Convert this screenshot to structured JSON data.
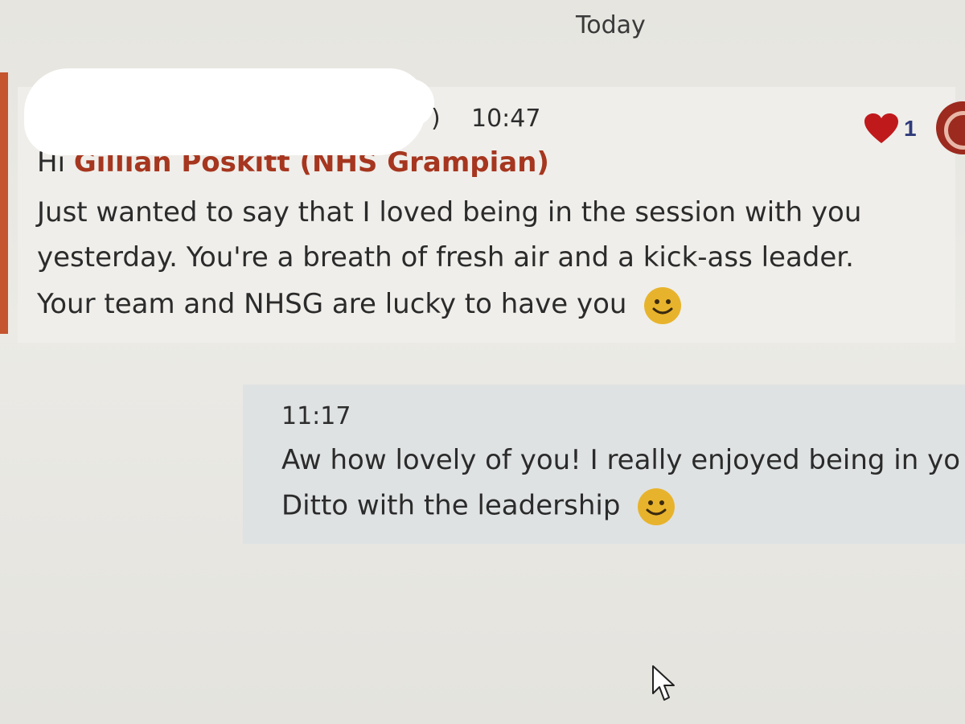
{
  "divider": {
    "date_label": "Today"
  },
  "incoming_message": {
    "sender_visible_fragment": ")",
    "time": "10:47",
    "greeting": "Hi",
    "mention": "Gillian Poskitt (NHS Grampian)",
    "lines": [
      "Just wanted to say that I loved being in the session with you",
      "yesterday. You're a breath of fresh air and a kick-ass leader.",
      "Your team and NHSG are lucky to have you"
    ],
    "reaction": {
      "icon": "heart-icon",
      "count": "1"
    },
    "colors": {
      "accent": "#c4552e",
      "mention": "#a6361f"
    }
  },
  "outgoing_message": {
    "time": "11:17",
    "lines": [
      "Aw how lovely of you! I really enjoyed being in yo",
      "Ditto with the leadership"
    ]
  },
  "icons": {
    "emoji": "smiley-emoji-icon",
    "cursor": "mouse-pointer-icon",
    "avatar": "avatar"
  }
}
